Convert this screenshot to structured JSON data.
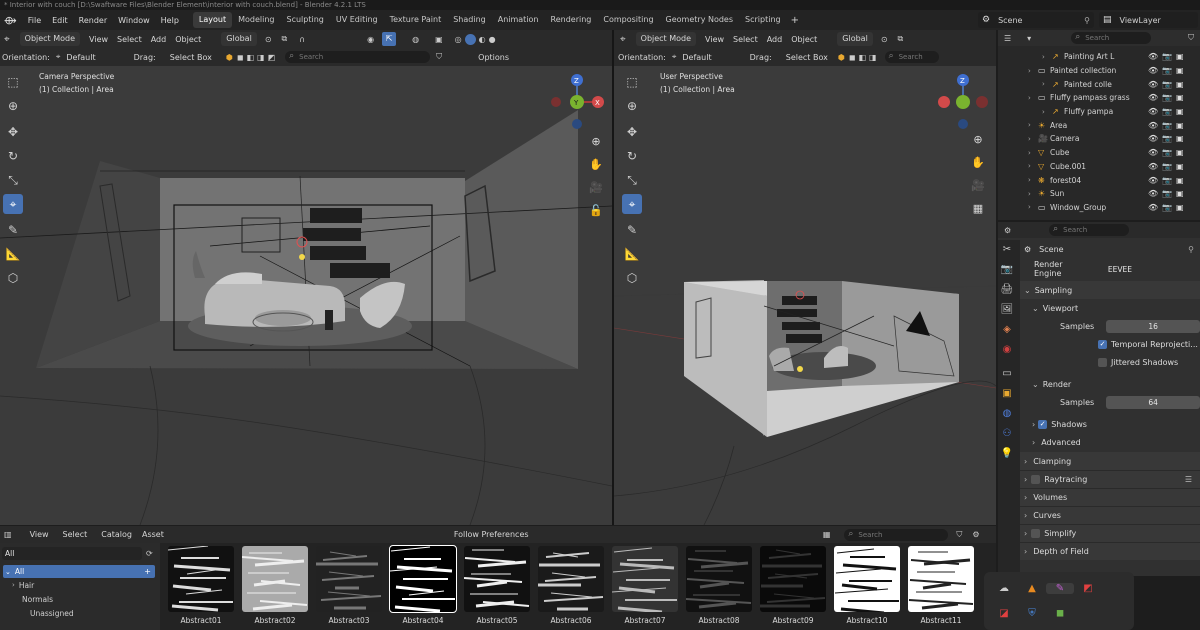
{
  "window": {
    "title": "* Interior with couch [D:\\Swaftware Files\\Blender Element\\interior with couch.blend] - Blender 4.2.1 LTS"
  },
  "menu": [
    "File",
    "Edit",
    "Render",
    "Window",
    "Help"
  ],
  "workspaces": [
    "Layout",
    "Modeling",
    "Sculpting",
    "UV Editing",
    "Texture Paint",
    "Shading",
    "Animation",
    "Rendering",
    "Compositing",
    "Geometry Nodes",
    "Scripting"
  ],
  "active_workspace": "Layout",
  "scene_selector": "Scene",
  "viewlayer_selector": "ViewLayer",
  "viewport_left": {
    "mode": "Object Mode",
    "menus": [
      "View",
      "Select",
      "Add",
      "Object"
    ],
    "transform": "Global",
    "orientation_label": "Orientation:",
    "orientation_value": "Default",
    "drag_label": "Drag:",
    "drag_value": "Select Box",
    "search_placeholder": "Search",
    "options": "Options",
    "perspective": "Camera Perspective",
    "collection": "(1) Collection | Area"
  },
  "viewport_right": {
    "mode": "Object Mode",
    "menus": [
      "View",
      "Select",
      "Add",
      "Object"
    ],
    "transform": "Global",
    "orientation_label": "Orientation:",
    "orientation_value": "Default",
    "drag_label": "Drag:",
    "drag_value": "Select Box",
    "search_placeholder": "Search",
    "perspective": "User Perspective",
    "collection": "(1) Collection | Area"
  },
  "gizmo": {
    "x": "X",
    "y": "Y",
    "z": "Z"
  },
  "outliner": {
    "search_placeholder": "Search",
    "rows": [
      {
        "label": "Painting Art L",
        "indent": 3
      },
      {
        "label": "Painted collection",
        "indent": 2
      },
      {
        "label": "Painted colle",
        "indent": 3
      },
      {
        "label": "Fluffy pampass grass",
        "indent": 2
      },
      {
        "label": "Fluffy pampa",
        "indent": 3
      },
      {
        "label": "Area",
        "indent": 2
      },
      {
        "label": "Camera",
        "indent": 2
      },
      {
        "label": "Cube",
        "indent": 2
      },
      {
        "label": "Cube.001",
        "indent": 2
      },
      {
        "label": "forest04",
        "indent": 2
      },
      {
        "label": "Sun",
        "indent": 2
      },
      {
        "label": "Window_Group",
        "indent": 2
      }
    ]
  },
  "properties": {
    "search_placeholder": "Search",
    "context": "Scene",
    "render_engine_label": "Render Engine",
    "render_engine_value": "EEVEE",
    "sampling": "Sampling",
    "viewport": "Viewport",
    "samples_label": "Samples",
    "viewport_samples": "16",
    "temporal": "Temporal Reprojecti...",
    "jittered": "Jittered Shadows",
    "render": "Render",
    "render_samples": "64",
    "shadows": "Shadows",
    "advanced": "Advanced",
    "clamping": "Clamping",
    "raytracing": "Raytracing",
    "volumes": "Volumes",
    "curves": "Curves",
    "simplify": "Simplify",
    "dof": "Depth of Field"
  },
  "asset_browser": {
    "menus": [
      "View",
      "Select",
      "Catalog",
      "Asset"
    ],
    "library": "Follow Preferences",
    "filter": "All",
    "search_placeholder": "Search",
    "tree": [
      "All",
      "Hair",
      "Normals",
      "Unassigned"
    ],
    "thumbnails": [
      "Abstract01",
      "Abstract02",
      "Abstract03",
      "Abstract04",
      "Abstract05",
      "Abstract06",
      "Abstract07",
      "Abstract08",
      "Abstract09",
      "Abstract10",
      "Abstract11"
    ]
  }
}
